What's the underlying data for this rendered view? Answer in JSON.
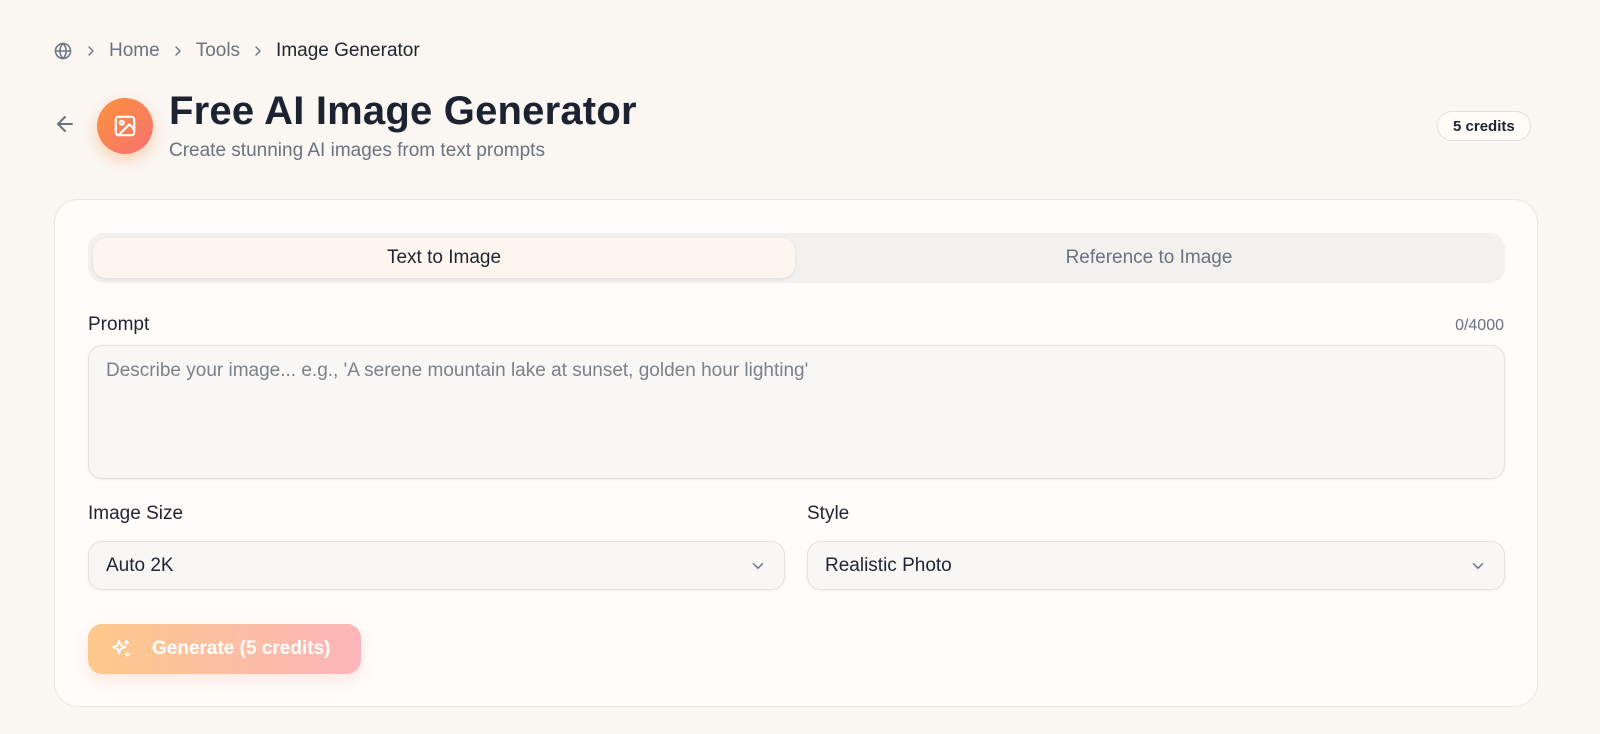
{
  "breadcrumb": {
    "home_icon": "globe-icon",
    "items": [
      "Home",
      "Tools",
      "Image Generator"
    ]
  },
  "header": {
    "back_icon": "arrow-left-icon",
    "app_icon": "image-icon",
    "title": "Free AI Image Generator",
    "subtitle": "Create stunning AI images from text prompts",
    "credits": "5 credits"
  },
  "tabs": [
    {
      "label": "Text to Image",
      "active": true
    },
    {
      "label": "Reference to Image",
      "active": false
    }
  ],
  "prompt": {
    "label": "Prompt",
    "counter": "0/4000",
    "value": "",
    "placeholder": "Describe your image... e.g., 'A serene mountain lake at sunset, golden hour lighting'"
  },
  "image_size": {
    "label": "Image Size",
    "value": "Auto 2K"
  },
  "style": {
    "label": "Style",
    "value": "Realistic Photo"
  },
  "generate": {
    "label": "Generate (5 credits)",
    "icon": "sparkles-icon",
    "enabled": false
  },
  "colors": {
    "accent_from": "#fb923c",
    "accent_to": "#f87171",
    "page_bg": "#faf6f1"
  }
}
